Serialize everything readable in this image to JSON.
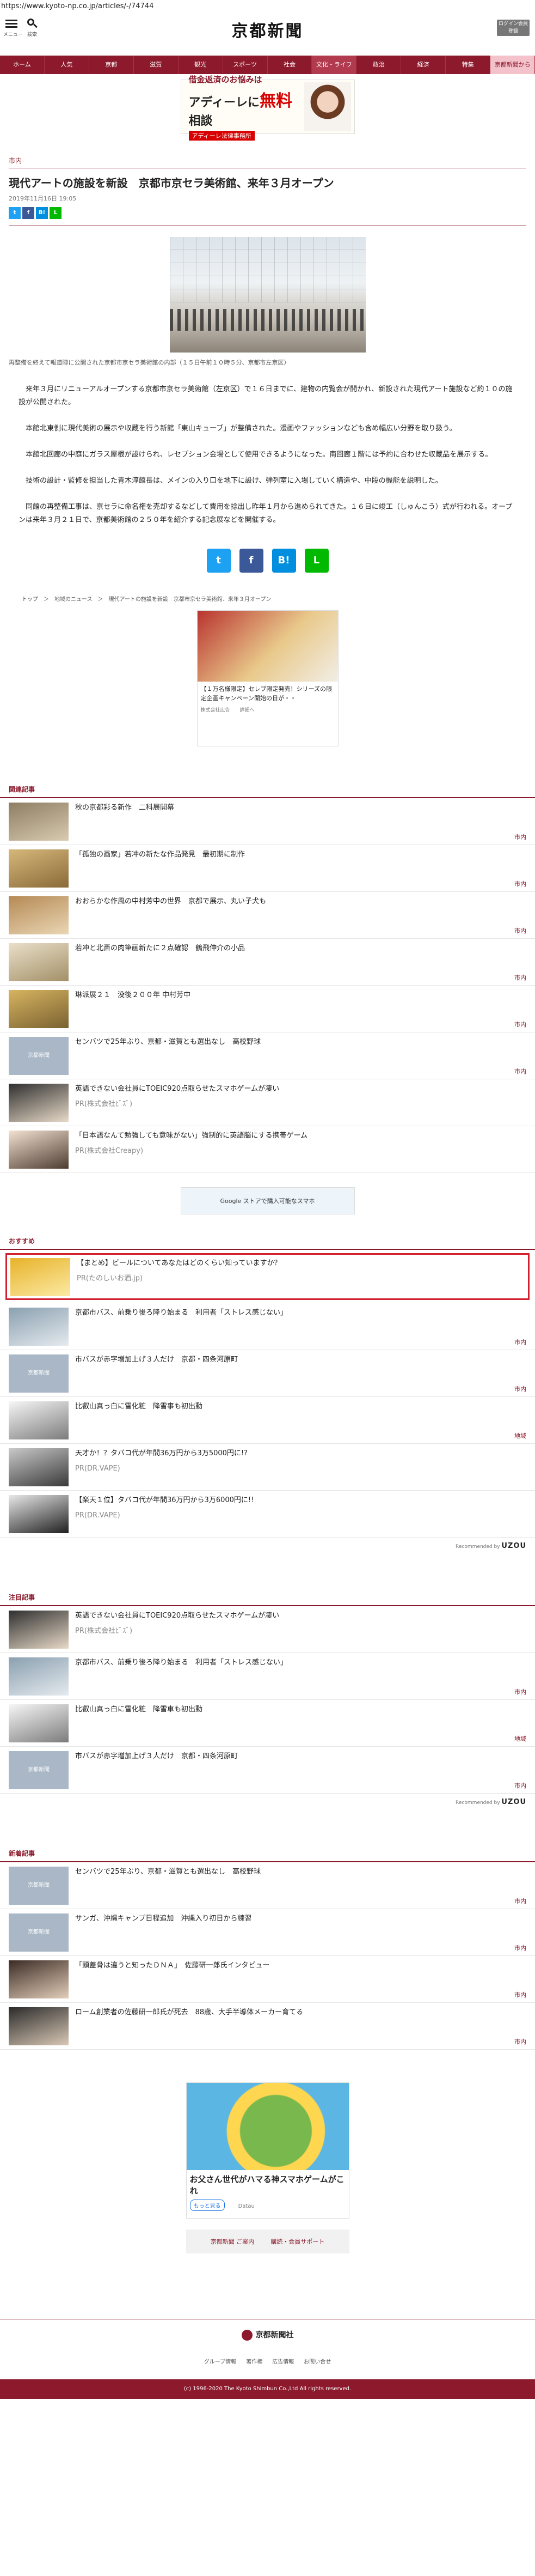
{
  "url": "https://www.kyoto-np.co.jp/articles/-/74744",
  "header": {
    "menu_caption": "メニュー",
    "search_caption": "検索",
    "logo": "京都新聞",
    "login": "ログイン会員登録"
  },
  "nav": [
    "ホーム",
    "人気",
    "京都",
    "滋賀",
    "観光",
    "スポーツ",
    "社会",
    "文化・ライフ",
    "政治",
    "経済",
    "特集",
    "京都新聞から"
  ],
  "top_ad": {
    "line1": "借金返済のお悩みは",
    "line2a": "アディーレに",
    "line2b": "無料",
    "line2c": "相談",
    "line3": "アディーレ法律事務所"
  },
  "article": {
    "category": "市内",
    "title": "現代アートの施設を新設　京都市京セラ美術館、来年３月オープン",
    "date": "2019年11月16日 19:05",
    "caption": "再整備を終えて報道陣に公開された京都市京セラ美術館の内部（１５日午前１０時５分、京都市左京区）",
    "paragraphs": [
      "来年３月にリニューアルオープンする京都市京セラ美術館（左京区）で１６日までに、建物の内覧会が開かれ、新設された現代アート施設など約１０の施設が公開された。",
      "本館北東側に現代美術の展示や収蔵を行う新館「東山キューブ」が整備された。漫画やファッションなども含め幅広い分野を取り扱う。",
      "本館北回廊の中庭にガラス屋根が設けられ、レセプション会場として使用できるようになった。南回廊１階には予約に合わせた収蔵品を展示する。",
      "技術の設計・監修を担当した青木淳館長は、メインの入り口を地下に設け、弾列室に入場していく構造や、中段の機能を説明した。",
      "同館の再整備工事は、京セラに命名権を売却するなどして費用を捻出し昨年１月から進められてきた。１６日に竣工（しゅんこう）式が行われる。オープンは来年３月２１日で、京都美術館の２５０年を紹介する記念展などを開催する。"
    ]
  },
  "crumbs": "トップ　＞　地域のニュース　＞　現代アートの施設を新設　京都市京セラ美術館、来年３月オープン",
  "mid_ad": {
    "text": "【１万名様限定】セレブ限定発売！シリーズの限定企画キャンペーン開始の日が・・",
    "source": "株式会社広告",
    "more": "詳細へ"
  },
  "related": {
    "title": "関連記事",
    "items": [
      {
        "text": "秋の京都彩る新作　二科展開幕",
        "tag": "市内"
      },
      {
        "text": "「孤独の画家」若冲の新たな作品発見　最初期に制作",
        "tag": "市内"
      },
      {
        "text": "おおらかな作風の中村芳中の世界　京都で展示、丸い子犬も",
        "tag": "市内"
      },
      {
        "text": "若冲と北斎の肉筆画新たに２点確認　鶴飛伸介の小品",
        "tag": "市内"
      },
      {
        "text": "琳派展２１　没後２００年 中村芳中",
        "tag": "市内"
      },
      {
        "text": "センバツで25年ぶり、京都・滋賀とも選出なし　高校野球",
        "tag": "市内"
      },
      {
        "text": "英語できない会社員にTOEIC920点取らせたスマホゲームが凄い",
        "pr": "PR(株式会社ﾋﾞｽﾞ)"
      },
      {
        "text": "「日本語なんて勉強しても意味がない」強制的に英語脳にする携帯ゲーム",
        "pr": "PR(株式会社Creapy)"
      }
    ]
  },
  "wide_ad": "Google ストアで購入可能なスマホ",
  "recommend": {
    "title": "おすすめ",
    "items": [
      {
        "text": "【まとめ】ビールについてあなたはどのくらい知っていますか？",
        "pr": "PR(たのしいお酒.jp)"
      },
      {
        "text": "京都市バス、前乗り後ろ降り始まる　利用者「ストレス感じない」",
        "tag": "市内"
      },
      {
        "text": "市バスが赤字増加上げ３人だけ　京都・四条河原町",
        "tag": "市内"
      },
      {
        "text": "比叡山真っ白に雪化粧　降雪事も初出動",
        "tag": "地域"
      },
      {
        "text": "天才か！？タバコ代が年間36万円から3万5000円に!?",
        "pr": "PR(DR.VAPE)"
      },
      {
        "text": "【楽天１位】タバコ代が年間36万円から3万6000円に!!",
        "pr": "PR(DR.VAPE)"
      }
    ],
    "by": "Recommended by",
    "brand": "UZOU"
  },
  "attention": {
    "title": "注目記事",
    "items": [
      {
        "text": "英語できない会社員にTOEIC920点取らせたスマホゲームが凄い",
        "pr": "PR(株式会社ﾋﾞｽﾞ)"
      },
      {
        "text": "京都市バス、前乗り後ろ降り始まる　利用者「ストレス感じない」",
        "tag": "市内"
      },
      {
        "text": "比叡山真っ白に雪化粧　降雪車も初出動",
        "tag": "地域"
      },
      {
        "text": "市バスが赤字増加上げ３人だけ　京都・四条河原町",
        "tag": "市内"
      }
    ],
    "by": "Recommended by",
    "brand": "UZOU"
  },
  "newest": {
    "title": "新着記事",
    "items": [
      {
        "text": "センバツで25年ぶり、京都・滋賀とも選出なし　高校野球",
        "tag": "市内"
      },
      {
        "text": "サンガ、沖縄キャンプ日程追加　沖縄入り初日から練習",
        "tag": "市内"
      },
      {
        "text": "「頭蓋骨は違うと知ったＤＮＡ」　佐藤研一郎氏インタビュー",
        "tag": "市内"
      },
      {
        "text": "ローム創業者の佐藤研一郎氏が死去　88歳、大手半導体メーカー育てる",
        "tag": "市内"
      }
    ]
  },
  "game_ad": {
    "title": "お父さん世代がハマる神スマホゲームがこれ",
    "btn": "もっと見る",
    "src": "Datau"
  },
  "links": [
    "京都新聞 ご案内",
    "購読・会員サポート"
  ],
  "footer": {
    "pub": "京都新聞社",
    "links": [
      "グループ情報",
      "著作権",
      "広告情報",
      "お問い合せ"
    ],
    "copy": "(c) 1996-2020 The Kyoto Shimbun Co.,Ltd All rights reserved."
  },
  "colors": {
    "brand": "#8c1a2c",
    "twitter": "#1da1f2",
    "facebook": "#3b5998",
    "hatena": "#008fde",
    "line": "#00b900"
  }
}
